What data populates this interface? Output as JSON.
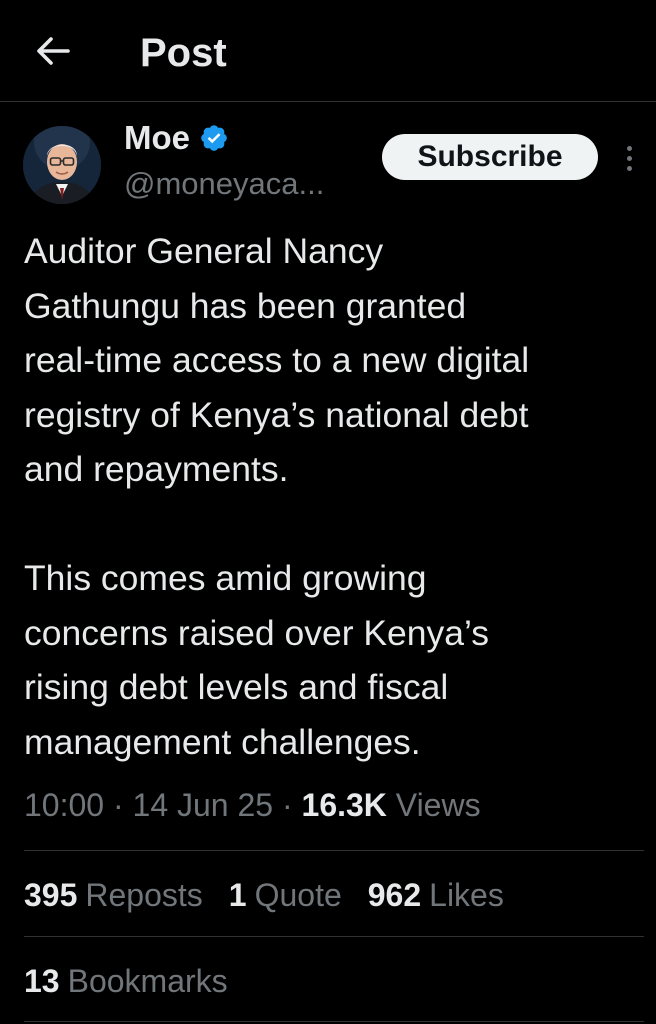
{
  "header": {
    "title": "Post",
    "back_icon": "arrow-left-icon"
  },
  "author": {
    "name": "Moe",
    "handle": "@moneyaca...",
    "verified_icon": "verified-badge-icon",
    "verified_color": "#1d9bf0"
  },
  "actions": {
    "subscribe_label": "Subscribe",
    "more_icon": "more-vertical-icon"
  },
  "post": {
    "text": "Auditor General Nancy\nGathungu has been granted\nreal-time access to a new digital\nregistry of Kenya’s national debt\nand repayments.\n\nThis comes amid growing\nconcerns raised over Kenya’s\nrising debt levels and fiscal\nmanagement challenges.",
    "time": "10:00",
    "date": "14 Jun 25",
    "views_count": "16.3K",
    "views_label": "Views"
  },
  "stats": {
    "reposts_count": "395",
    "reposts_label": "Reposts",
    "quotes_count": "1",
    "quotes_label": "Quote",
    "likes_count": "962",
    "likes_label": "Likes",
    "bookmarks_count": "13",
    "bookmarks_label": "Bookmarks"
  },
  "colors": {
    "background": "#000000",
    "text_primary": "#e7e9ea",
    "text_secondary": "#71767b",
    "divider": "#2f3336",
    "accent": "#1d9bf0"
  }
}
